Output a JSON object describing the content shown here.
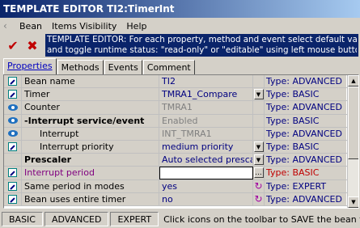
{
  "window": {
    "title": "TEMPLATE EDITOR TI2:TimerInt"
  },
  "menu": {
    "items": [
      "Bean",
      "Items Visibility",
      "Help"
    ]
  },
  "toolbar": {
    "ok_icon": "checkmark-icon",
    "cancel_icon": "close-icon"
  },
  "info": {
    "line1": "TEMPLATE EDITOR: For each property, method and event select default value",
    "line2": "and toggle runtime status: \"read-only\" or \"editable\" using left mouse button click."
  },
  "tabs": [
    {
      "label": "Properties",
      "active": true
    },
    {
      "label": "Methods"
    },
    {
      "label": "Events"
    },
    {
      "label": "Comment"
    }
  ],
  "grid": {
    "rows": [
      {
        "icon": "edit-icon",
        "name": "Bean name",
        "value": "TI2",
        "control": "",
        "type": "Type: ADVANCED",
        "cls": ""
      },
      {
        "icon": "edit-icon",
        "name": "Timer",
        "value": "TMRA1_Compare",
        "control": "dropdown",
        "type": "Type: BASIC",
        "cls": ""
      },
      {
        "icon": "eye-icon",
        "name": "Counter",
        "value": "TMRA1",
        "control": "",
        "type": "Type: ADVANCED",
        "cls": "disabled"
      },
      {
        "icon": "eye-icon",
        "name": "-Interrupt service/event",
        "value": "Enabled",
        "control": "",
        "type": "Type: BASIC",
        "cls": "bold disabled"
      },
      {
        "icon": "eye-icon",
        "name": "Interrupt",
        "value": "INT_TMRA1",
        "control": "",
        "type": "Type: ADVANCED",
        "cls": "indent disabled"
      },
      {
        "icon": "edit-icon",
        "name": "Interrupt priority",
        "value": "medium priority",
        "control": "dropdown",
        "type": "Type: BASIC",
        "cls": "indent"
      },
      {
        "icon": "",
        "name": "Prescaler",
        "value": "Auto selected presca",
        "control": "dropdown",
        "type": "Type: ADVANCED",
        "cls": "bold"
      },
      {
        "icon": "edit-icon",
        "name": "Interrupt period",
        "value": "",
        "control": "ellipsis",
        "type": "Type: BASIC",
        "cls": "purple editing"
      },
      {
        "icon": "edit-icon",
        "name": "Same period in modes",
        "value": "yes",
        "control": "reset",
        "type": "Type: EXPERT",
        "cls": ""
      },
      {
        "icon": "edit-icon",
        "name": "Bean uses entire timer",
        "value": "no",
        "control": "reset",
        "type": "Type: ADVANCED",
        "cls": ""
      }
    ]
  },
  "status": {
    "buttons": [
      "BASIC",
      "ADVANCED",
      "EXPERT"
    ],
    "message": "Click icons on the toolbar to SAVE the bean te"
  }
}
